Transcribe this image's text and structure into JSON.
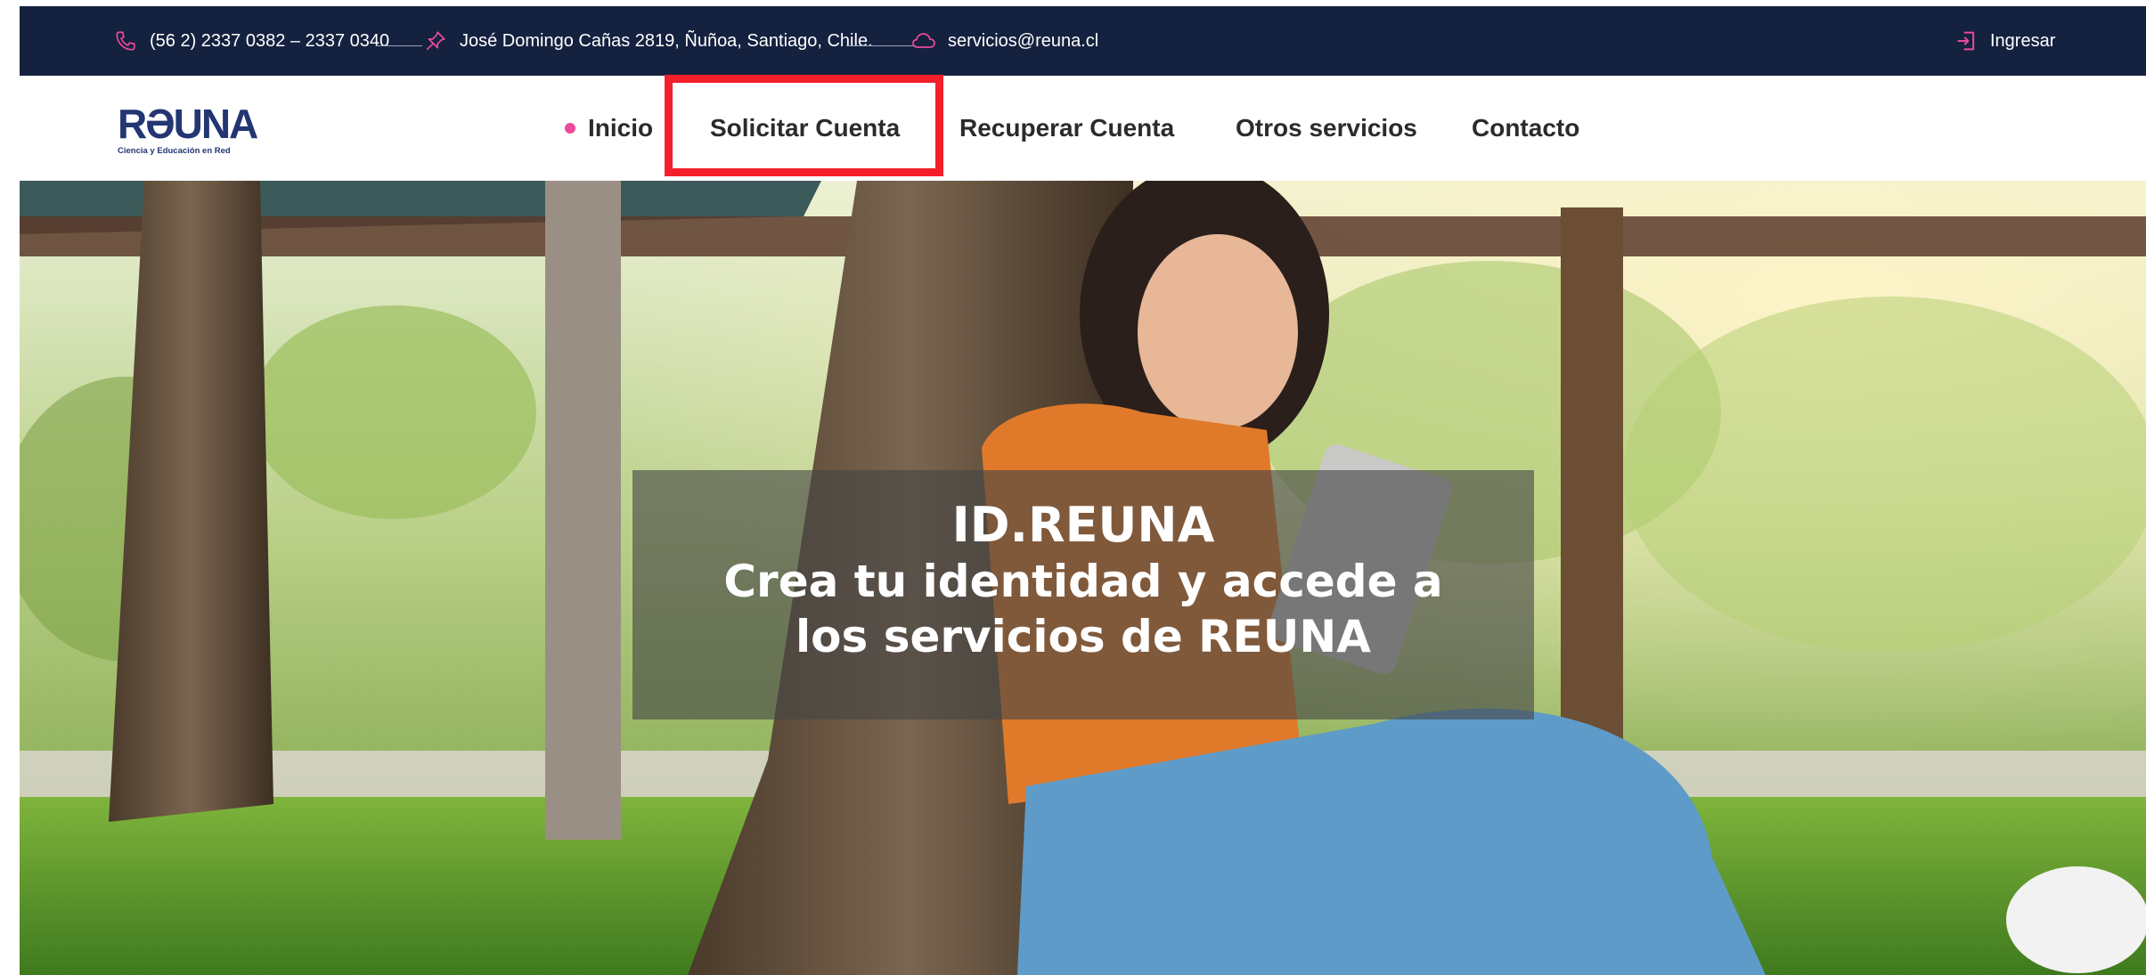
{
  "topbar": {
    "phone": "(56 2) 2337 0382 – 2337 0340",
    "address": "José Domingo Cañas 2819, Ñuñoa, Santiago, Chile.",
    "email": "servicios@reuna.cl",
    "login": "Ingresar",
    "accent_color": "#ec4a9a",
    "background_color": "#14213f"
  },
  "logo": {
    "word": "RƏUNA",
    "tagline": "Ciencia y Educación en Red"
  },
  "nav": {
    "items": [
      {
        "label": "Inicio",
        "active": true
      },
      {
        "label": "Solicitar Cuenta",
        "highlighted": true
      },
      {
        "label": "Recuperar Cuenta"
      },
      {
        "label": "Otros servicios"
      },
      {
        "label": "Contacto"
      }
    ],
    "active_dot_color": "#ec4a9a",
    "highlight_color": "#f31f2a"
  },
  "hero": {
    "title": "ID.REUNA",
    "subtitle": "Crea tu identidad y accede a los servicios de REUNA"
  },
  "icons": [
    "phone-icon",
    "pin-icon",
    "cloud-icon",
    "login-icon"
  ]
}
